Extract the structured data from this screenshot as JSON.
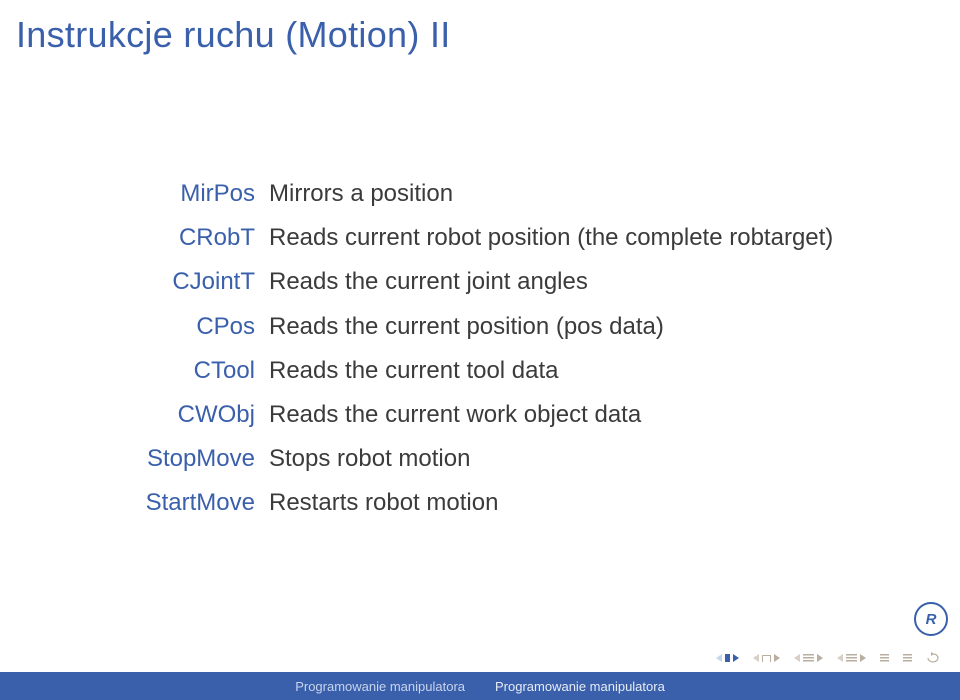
{
  "title": "Instrukcje ruchu (Motion) II",
  "rows": [
    {
      "term": "MirPos",
      "desc": "Mirrors a position"
    },
    {
      "term": "CRobT",
      "desc": "Reads current robot position (the complete robtarget)"
    },
    {
      "term": "CJointT",
      "desc": "Reads the current joint angles"
    },
    {
      "term": "CPos",
      "desc": "Reads the current position (pos data)"
    },
    {
      "term": "CTool",
      "desc": "Reads the current tool data"
    },
    {
      "term": "CWObj",
      "desc": "Reads the current work object data"
    },
    {
      "term": "StopMove",
      "desc": "Stops robot motion"
    },
    {
      "term": "StartMove",
      "desc": "Restarts robot motion"
    }
  ],
  "footer": {
    "left": "Programowanie manipulatora",
    "right": "Programowanie manipulatora"
  },
  "logo": "R"
}
